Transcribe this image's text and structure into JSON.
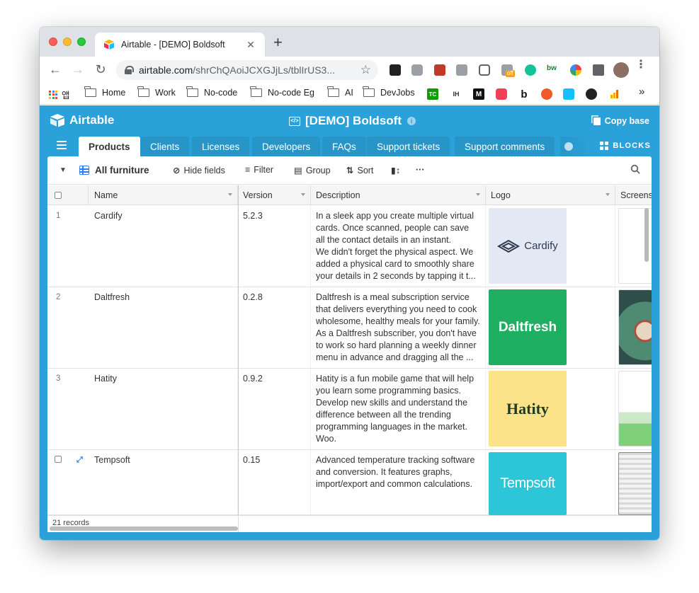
{
  "browser": {
    "tab_title": "Airtable - [DEMO] Boldsoft",
    "tab_close": "✕",
    "new_tab": "+",
    "url_host": "airtable.com",
    "url_path": "/shrChQAoiJCXGJjLs/tblIrUS3...",
    "extension_badge": "off",
    "extension_bw": "bw",
    "bookmarks": {
      "apps": "앱",
      "items": [
        "Home",
        "Work",
        "No-code",
        "No-code Eg",
        "AI",
        "DevJobs"
      ],
      "icon_tc": "TC",
      "icon_ih": "IH",
      "icon_m": "M",
      "icon_b": "b",
      "more": "»"
    }
  },
  "app": {
    "brand": "Airtable",
    "base_title": "[DEMO] Boldsoft",
    "copy_base": "Copy base",
    "blocks": "BLOCKS",
    "tables": [
      "Products",
      "Clients",
      "Licenses",
      "Developers",
      "FAQs",
      "Support tickets",
      "Support comments"
    ],
    "active_table": "Products",
    "view": {
      "name": "All furniture",
      "hide_fields": "Hide fields",
      "filter": "Filter",
      "group": "Group",
      "sort": "Sort",
      "more": "···"
    },
    "columns": [
      "Name",
      "Version",
      "Description",
      "Logo",
      "Screens"
    ],
    "rows": [
      {
        "num": "1",
        "name": "Cardify",
        "version": "5.2.3",
        "description": "In a sleek app you create multiple virtual cards. Once scanned, people can save all the contact details in an instant.\nWe didn't forget the physical aspect. We added a physical card to smoothly share your details in 2 seconds by tapping it t...",
        "logo_text": "Cardify",
        "logo_bg": "#e3e9f4",
        "logo_fg": "#2f3a4f"
      },
      {
        "num": "2",
        "name": "Daltfresh",
        "version": "0.2.8",
        "description": "Daltfresh is a meal subscription service that delivers everything you need to cook wholesome, healthy meals for your family. As a Daltfresh subscriber, you don't have to work so hard planning a weekly dinner menu in advance and dragging all the ...",
        "logo_text": "Daltfresh",
        "logo_bg": "#1faf63",
        "logo_fg": "#ffffff"
      },
      {
        "num": "3",
        "name": "Hatity",
        "version": "0.9.2",
        "description": "Hatity is a fun mobile game that will help you learn some programming basics. Develop new skills and understand the difference between all the trending programming languages in the market. Woo.",
        "logo_text": "Hatity",
        "logo_bg": "#fce38a",
        "logo_fg": "#1d3b2a"
      },
      {
        "num": "",
        "name": "Tempsoft",
        "version": "0.15",
        "description": "Advanced temperature tracking software and conversion. It features graphs, import/export and common calculations.",
        "logo_text": "Tempsoft",
        "logo_bg": "#2cc6d8",
        "logo_fg": "#ffffff"
      }
    ],
    "record_count": "21 records",
    "colors": {
      "header_blue": "#2aa1d8",
      "accent": "#2d7ff9"
    }
  }
}
